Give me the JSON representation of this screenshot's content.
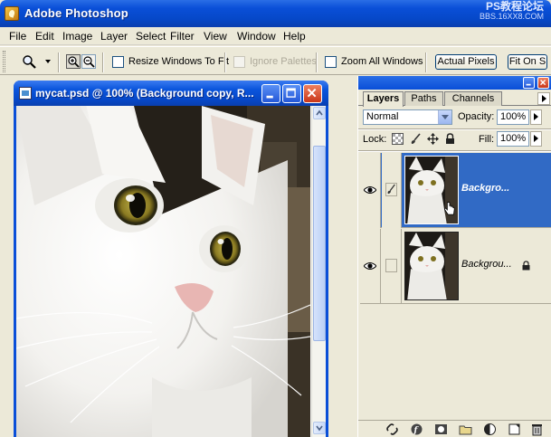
{
  "app": {
    "title": "Adobe Photoshop",
    "watermark_line1": "PS教程论坛",
    "watermark_line2": "BBS.16XX8.COM"
  },
  "menu": [
    {
      "id": "file",
      "label": "File"
    },
    {
      "id": "edit",
      "label": "Edit"
    },
    {
      "id": "image",
      "label": "Image"
    },
    {
      "id": "layer",
      "label": "Layer"
    },
    {
      "id": "select",
      "label": "Select"
    },
    {
      "id": "filter",
      "label": "Filter"
    },
    {
      "id": "view",
      "label": "View"
    },
    {
      "id": "window",
      "label": "Window"
    },
    {
      "id": "help",
      "label": "Help"
    }
  ],
  "options": {
    "tool_icon": "zoom-tool-icon",
    "resize_windows": {
      "label": "Resize Windows To Fit",
      "checked": false,
      "enabled": true
    },
    "ignore_palettes": {
      "label": "Ignore Palettes",
      "checked": false,
      "enabled": false
    },
    "zoom_all": {
      "label": "Zoom All Windows",
      "checked": false,
      "enabled": true
    },
    "actual_pixels": "Actual Pixels",
    "fit_on_screen": "Fit On S"
  },
  "document": {
    "title": "mycat.psd @ 100% (Background copy, R..."
  },
  "layers_panel": {
    "tabs": [
      "Layers",
      "Paths",
      "Channels"
    ],
    "active_tab": "Layers",
    "blend_mode": "Normal",
    "opacity_label": "Opacity:",
    "opacity": "100%",
    "lock_label": "Lock:",
    "fill_label": "Fill:",
    "fill": "100%",
    "layers": [
      {
        "name": "Background copy",
        "display": "Backgro...",
        "selected": true,
        "visible": true,
        "locked": false,
        "brush": true
      },
      {
        "name": "Background",
        "display": "Backgrou...",
        "selected": false,
        "visible": true,
        "locked": true,
        "brush": false
      }
    ]
  },
  "colors": {
    "titlebar": "#0a4fd8",
    "selection": "#316ac5",
    "panel_bg": "#ece9d8",
    "close_button": "#d8502c"
  }
}
